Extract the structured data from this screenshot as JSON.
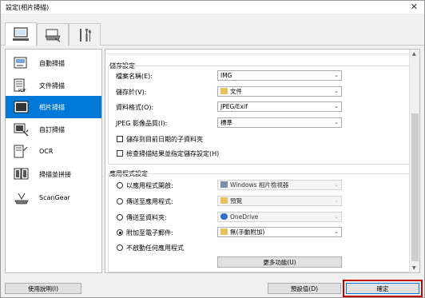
{
  "window": {
    "title": "設定(相片掃描)",
    "close_glyph": "✕"
  },
  "tabs": [
    {
      "name": "scan-from-computer",
      "icon": "computer-icon"
    },
    {
      "name": "scan-from-panel",
      "icon": "scanner-icon"
    },
    {
      "name": "general-settings",
      "icon": "tools-icon"
    }
  ],
  "sidebar": {
    "items": [
      {
        "label": "自動掃描",
        "icon": "auto-scan-icon",
        "active": false
      },
      {
        "label": "文件掃描",
        "icon": "document-scan-icon",
        "active": false
      },
      {
        "label": "相片掃描",
        "icon": "photo-scan-icon",
        "active": true
      },
      {
        "label": "自訂掃描",
        "icon": "custom-scan-icon",
        "active": false
      },
      {
        "label": "OCR",
        "icon": "ocr-icon",
        "active": false
      },
      {
        "label": "掃描並拼接",
        "icon": "stitch-icon",
        "active": false
      },
      {
        "label": "ScanGear",
        "icon": "scangear-icon",
        "active": false
      }
    ]
  },
  "save_settings": {
    "title": "儲存設定",
    "file_name_label": "檔案名稱(E):",
    "file_name_value": "IMG",
    "save_in_label": "儲存於(V):",
    "save_in_value": "文件",
    "data_format_label": "資料格式(O):",
    "data_format_value": "JPEG/Exif",
    "jpeg_quality_label": "JPEG 影像品質(I):",
    "jpeg_quality_value": "標準",
    "subfolder_label": "儲存到目前日期的子資料夾",
    "check_results_label": "檢查掃描結果並指定儲存設定(H)"
  },
  "app_settings": {
    "title": "應用程式設定",
    "open_with_label": "以應用程式開啟:",
    "open_with_value": "Windows 相片檢視器",
    "send_to_app_label": "傳送至應用程式:",
    "send_to_app_value": "預覽",
    "send_to_folder_label": "傳送至資料夾:",
    "send_to_folder_value": "OneDrive",
    "attach_email_label": "附加至電子郵件:",
    "attach_email_value": "無(手動附加)",
    "no_start_label": "不啟動任何應用程式",
    "more_functions_label": "更多功能(U)"
  },
  "footer": {
    "help_label": "使用說明(I)",
    "defaults_label": "預設值(D)",
    "ok_label": "確定"
  },
  "colors": {
    "accent": "#0078d7",
    "highlight": "#c00000"
  }
}
